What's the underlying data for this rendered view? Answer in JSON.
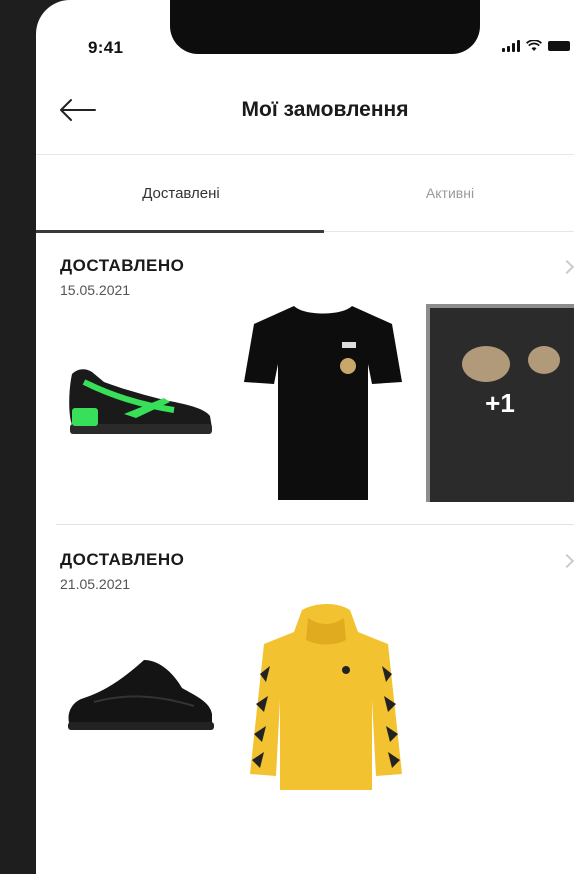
{
  "status_bar": {
    "time": "9:41"
  },
  "header": {
    "title": "Мої замовлення"
  },
  "tabs": [
    {
      "label": "Доставлені",
      "active": true
    },
    {
      "label": "Активні",
      "active": false
    }
  ],
  "orders": [
    {
      "status": "ДОСТАВЛЕНО",
      "date": "15.05.2021",
      "items": [
        "green-black-sneaker",
        "black-tshirt",
        "black-sweatshirt"
      ],
      "more_count": "+1"
    },
    {
      "status": "ДОСТАВЛЕНО",
      "date": "21.05.2021",
      "items": [
        "black-knit-sneaker",
        "yellow-hoodie"
      ]
    }
  ],
  "colors": {
    "accent_green": "#38e05a",
    "hoodie_yellow": "#f2c230",
    "indicator": "#3a3a3a"
  }
}
